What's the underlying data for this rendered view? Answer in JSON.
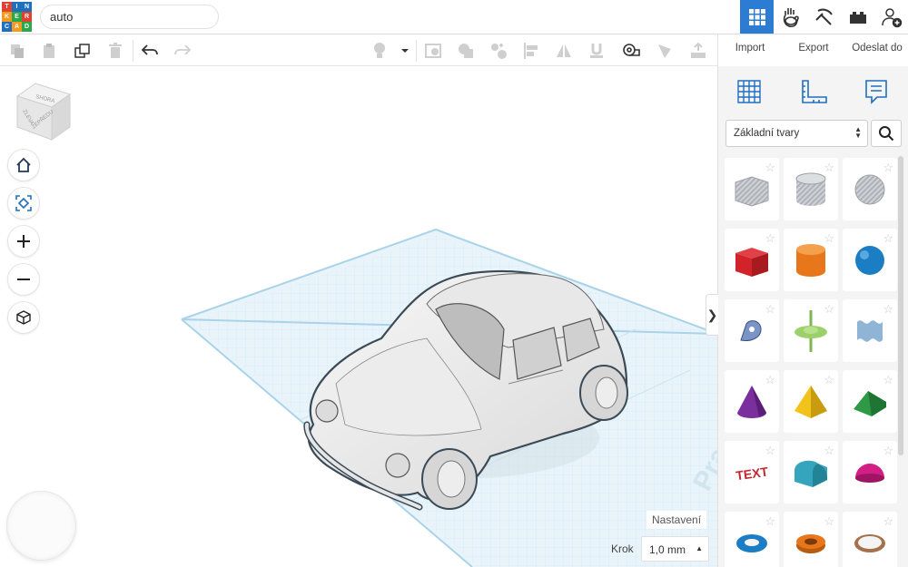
{
  "logo": {
    "letters": [
      "T",
      "I",
      "N",
      "K",
      "E",
      "R",
      "C",
      "A",
      "D"
    ],
    "colors": [
      "#e2412f",
      "#1f6fc0",
      "#1f6fc0",
      "#f39a1f",
      "#2aa84a",
      "#e2412f",
      "#1f6fc0",
      "#f39a1f",
      "#2aa84a"
    ]
  },
  "project": {
    "name": "auto"
  },
  "topbar": {
    "icons": [
      "grid-view-icon",
      "hand-tinker-icon",
      "pickaxe-icon",
      "bricks-icon",
      "add-user-icon"
    ],
    "active_color": "#2d7cd3"
  },
  "toolbar": {
    "icons": [
      "copy-icon",
      "paste-icon",
      "duplicate-icon",
      "delete-icon",
      "undo-icon",
      "redo-icon",
      "light-bulb-icon",
      "dropdown-icon",
      "workplane-icon",
      "group-icon",
      "ungroup-icon",
      "align-icon",
      "mirror-icon",
      "snap-icon",
      "ruler-icon",
      "notes-icon",
      "import-export-icon"
    ]
  },
  "panel": {
    "links": [
      "Import",
      "Export",
      "Odeslat do"
    ],
    "tools": [
      "workplane-grid-icon",
      "ruler-tool-icon",
      "notes-tool-icon"
    ],
    "category": "Základní tvary",
    "shapes": [
      {
        "name": "box-hole",
        "color": "#b9bcc2"
      },
      {
        "name": "cylinder-hole",
        "color": "#b9bcc2"
      },
      {
        "name": "sphere-hole",
        "color": "#b9bcc2"
      },
      {
        "name": "box",
        "color": "#d2232a"
      },
      {
        "name": "cylinder",
        "color": "#e8771c"
      },
      {
        "name": "sphere",
        "color": "#1b7ec4"
      },
      {
        "name": "scribble",
        "color": "#7a94c7"
      },
      {
        "name": "spinner",
        "color": "#9cd06b"
      },
      {
        "name": "shape-generator",
        "color": "#8fb4d6"
      },
      {
        "name": "cone",
        "color": "#7b2f9e"
      },
      {
        "name": "pyramid",
        "color": "#f2c31b"
      },
      {
        "name": "roof",
        "color": "#2e9a46"
      },
      {
        "name": "text",
        "color": "#c4262e"
      },
      {
        "name": "half-cylinder",
        "color": "#35a5bd"
      },
      {
        "name": "half-sphere",
        "color": "#d11f86"
      },
      {
        "name": "torus",
        "color": "#1b7ec4"
      },
      {
        "name": "tube",
        "color": "#e8771c"
      },
      {
        "name": "ring",
        "color": "#a5704a"
      }
    ],
    "text_shape_label": "TEXT"
  },
  "viewcube": {
    "faces": [
      "SHORA",
      "ZLEVA",
      "ZEPŘEDU"
    ]
  },
  "nav": [
    "home-icon",
    "fit-view-icon",
    "zoom-in-icon",
    "zoom-out-icon",
    "ortho-view-icon"
  ],
  "workplane": {
    "watermark": "Pracovní plocha"
  },
  "bottom": {
    "settings": "Nastavení",
    "step_label": "Krok",
    "step_value": "1,0 mm"
  }
}
